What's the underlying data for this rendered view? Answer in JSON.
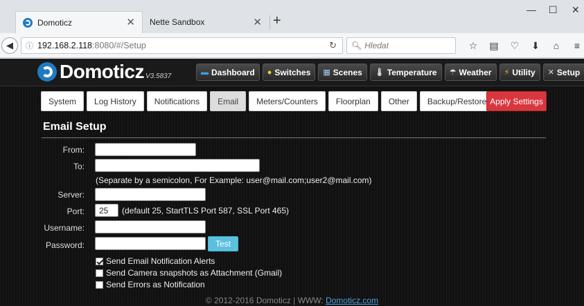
{
  "browser": {
    "tabs": [
      {
        "title": "Domoticz"
      },
      {
        "title": "Nette Sandbox"
      }
    ],
    "url_host": "192.168.2.118",
    "url_path": ":8080/#/Setup",
    "search_placeholder": "Hledat"
  },
  "app": {
    "name": "Domoticz",
    "version": "V3.5837",
    "menu": [
      {
        "label": "Dashboard",
        "icon": "dashboard-icon"
      },
      {
        "label": "Switches",
        "icon": "bulb-icon"
      },
      {
        "label": "Scenes",
        "icon": "scenes-icon"
      },
      {
        "label": "Temperature",
        "icon": "thermometer-icon"
      },
      {
        "label": "Weather",
        "icon": "weather-icon"
      },
      {
        "label": "Utility",
        "icon": "utility-icon"
      },
      {
        "label": "Setup",
        "icon": "tools-icon"
      }
    ]
  },
  "setup": {
    "tabs": [
      "System",
      "Log History",
      "Notifications",
      "Email",
      "Meters/Counters",
      "Floorplan",
      "Other",
      "Backup/Restore"
    ],
    "active_tab": "Email",
    "apply_label": "Apply Settings",
    "section_title": "Email Setup",
    "form": {
      "from_label": "From:",
      "from_value": "",
      "to_label": "To:",
      "to_value": "",
      "to_note": "(Separate by a semicolon, For Example: user@mail.com;user2@mail.com)",
      "server_label": "Server:",
      "server_value": "",
      "port_label": "Port:",
      "port_value": "25",
      "port_note": "(default 25, StartTLS Port 587, SSL Port 465)",
      "username_label": "Username:",
      "username_value": "",
      "password_label": "Password:",
      "password_value": "",
      "test_label": "Test",
      "checkboxes": [
        {
          "label": "Send Email Notification Alerts",
          "checked": true
        },
        {
          "label": "Send Camera snapshots as Attachment (Gmail)",
          "checked": false
        },
        {
          "label": "Send Errors as Notification",
          "checked": false
        }
      ]
    }
  },
  "footer": {
    "text": "© 2012-2016 Domoticz | WWW:",
    "link": "Domoticz.com"
  }
}
